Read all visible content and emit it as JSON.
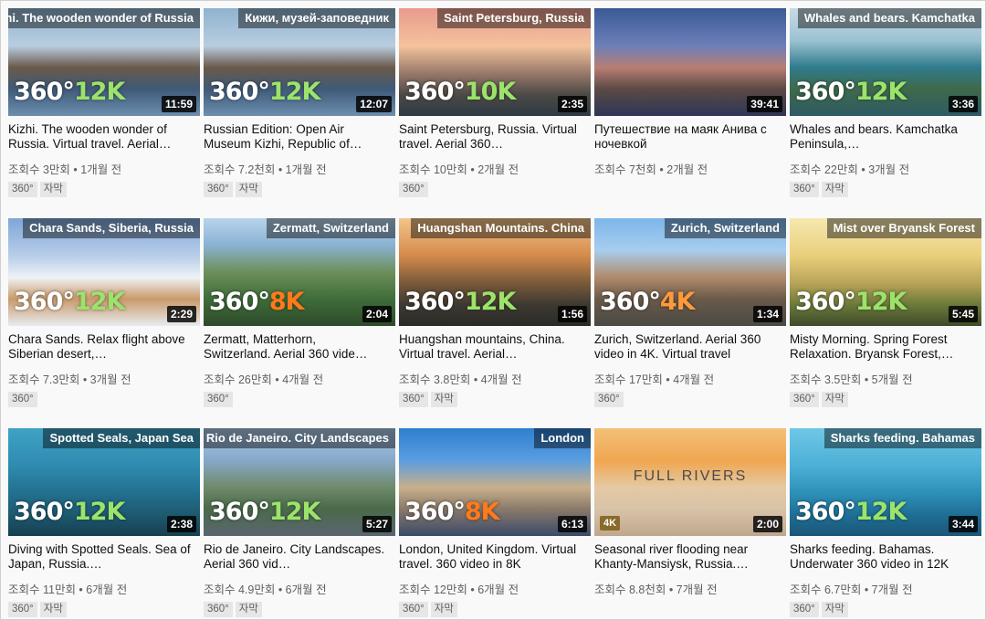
{
  "labels": {
    "overlay_prefix": "360°"
  },
  "videos": [
    {
      "banner": "Kizhi. The wooden wonder of Russia",
      "res": "12K",
      "res_color": "#9be36a",
      "duration": "11:59",
      "title": "Kizhi. The wooden wonder of Russia. Virtual travel. Aerial…",
      "meta": "조회수 3만회 • 1개월 전",
      "badges": [
        "360°",
        "자막"
      ]
    },
    {
      "banner": "Кижи, музей-заповедник",
      "res": "12K",
      "res_color": "#9be36a",
      "duration": "12:07",
      "title": "Russian Edition: Open Air Museum Kizhi, Republic of…",
      "meta": "조회수 7.2천회 • 1개월 전",
      "badges": [
        "360°",
        "자막"
      ]
    },
    {
      "banner": "Saint Petersburg, Russia",
      "res": "10K",
      "res_color": "#9be36a",
      "duration": "2:35",
      "title": "Saint Petersburg, Russia. Virtual travel. Aerial 360…",
      "meta": "조회수 10만회 • 2개월 전",
      "badges": [
        "360°"
      ]
    },
    {
      "banner": "",
      "res": "",
      "res_color": "#ffffff",
      "duration": "39:41",
      "title": "Путешествие на маяк Анива с ночевкой",
      "meta": "조회수 7천회 • 2개월 전",
      "badges": []
    },
    {
      "banner": "Whales and bears. Kamchatka",
      "res": "12K",
      "res_color": "#9be36a",
      "duration": "3:36",
      "title": "Whales and bears. Kamchatka Peninsula,…",
      "meta": "조회수 22만회 • 3개월 전",
      "badges": [
        "360°",
        "자막"
      ]
    },
    {
      "banner": "Chara Sands, Siberia, Russia",
      "res": "12K",
      "res_color": "#9be36a",
      "duration": "2:29",
      "title": "Chara Sands. Relax flight above Siberian desert,…",
      "meta": "조회수 7.3만회 • 3개월 전",
      "badges": [
        "360°"
      ]
    },
    {
      "banner": "Zermatt, Switzerland",
      "res": "8K",
      "res_color": "#ff7a1a",
      "duration": "2:04",
      "title": "Zermatt, Matterhorn, Switzerland. Aerial 360 vide…",
      "meta": "조회수 26만회 • 4개월 전",
      "badges": [
        "360°"
      ]
    },
    {
      "banner": "Huangshan Mountains. China",
      "res": "12K",
      "res_color": "#9be36a",
      "duration": "1:56",
      "title": "Huangshan mountains, China. Virtual travel. Aerial…",
      "meta": "조회수 3.8만회 • 4개월 전",
      "badges": [
        "360°",
        "자막"
      ]
    },
    {
      "banner": "Zurich, Switzerland",
      "res": "4K",
      "res_color": "#ff9a3c",
      "duration": "1:34",
      "title": "Zurich, Switzerland. Aerial 360 video in 4K. Virtual travel",
      "meta": "조회수 17만회 • 4개월 전",
      "badges": [
        "360°"
      ]
    },
    {
      "banner": "Mist over Bryansk Forest",
      "res": "12K",
      "res_color": "#9be36a",
      "duration": "5:45",
      "title": "Misty Morning. Spring Forest Relaxation. Bryansk Forest,…",
      "meta": "조회수 3.5만회 • 5개월 전",
      "badges": [
        "360°",
        "자막"
      ]
    },
    {
      "banner": "Spotted Seals, Japan Sea",
      "res": "12K",
      "res_color": "#9be36a",
      "duration": "2:38",
      "title": "Diving with Spotted Seals. Sea of Japan, Russia.…",
      "meta": "조회수 11만회 • 6개월 전",
      "badges": [
        "360°",
        "자막"
      ]
    },
    {
      "banner": "Rio de Janeiro. City Landscapes",
      "res": "12K",
      "res_color": "#9be36a",
      "duration": "5:27",
      "title": "Rio de Janeiro. City Landscapes. Aerial 360 vid…",
      "meta": "조회수 4.9만회 • 6개월 전",
      "badges": [
        "360°",
        "자막"
      ]
    },
    {
      "banner": "London",
      "res": "8K",
      "res_color": "#ff7a1a",
      "duration": "6:13",
      "title": "London, United Kingdom. Virtual travel. 360 video in 8K",
      "meta": "조회수 12만회 • 6개월 전",
      "badges": [
        "360°",
        "자막"
      ]
    },
    {
      "banner": "",
      "res": "",
      "res_color": "#ffffff",
      "duration": "2:00",
      "title": "Seasonal river flooding near Khanty-Mansiysk, Russia.…",
      "meta": "조회수 8.8천회 • 7개월 전",
      "badges": [],
      "center_text": "FULL RIVERS",
      "corner_badge": "4K"
    },
    {
      "banner": "Sharks feeding. Bahamas",
      "res": "12K",
      "res_color": "#9be36a",
      "duration": "3:44",
      "title": "Sharks feeding. Bahamas. Underwater 360 video in 12K",
      "meta": "조회수 6.7만회 • 7개월 전",
      "badges": [
        "360°",
        "자막"
      ]
    }
  ]
}
